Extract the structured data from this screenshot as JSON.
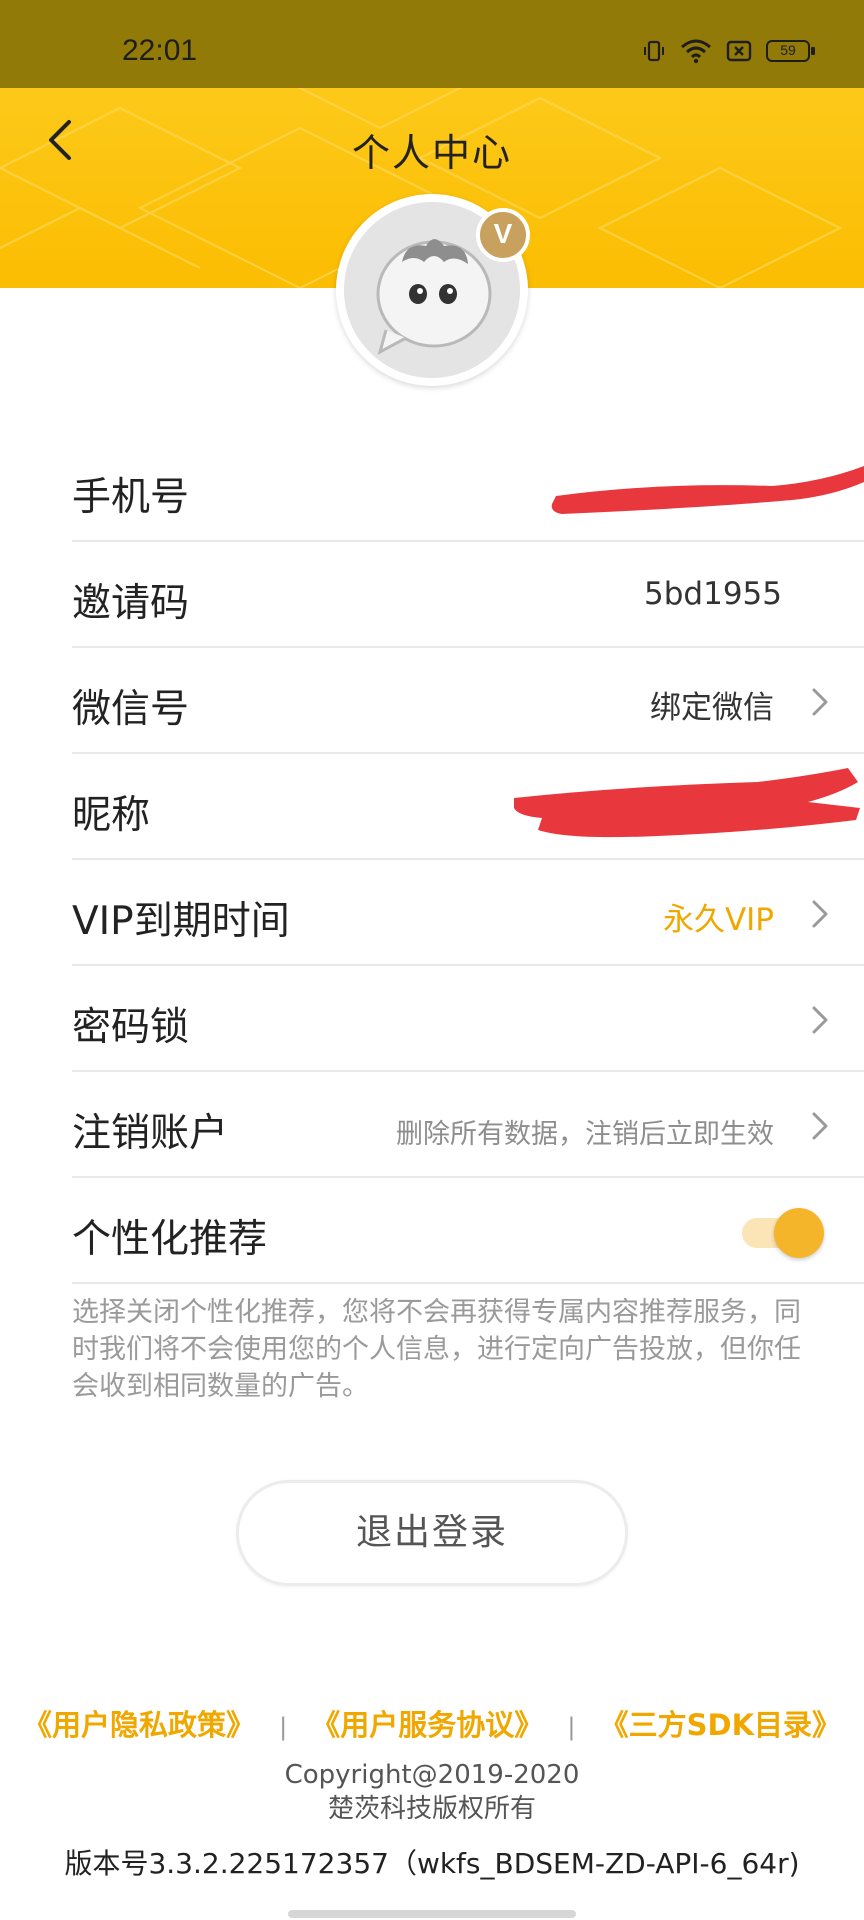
{
  "status_bar": {
    "time": "22:01",
    "battery": "59",
    "icons": [
      "vibrate-icon",
      "wifi-icon",
      "sim-icon",
      "battery-icon"
    ]
  },
  "header": {
    "title": "个人中心",
    "back_icon": "chevron-left-icon",
    "background_color": "#fbbd02",
    "vip_badge": "V"
  },
  "rows": [
    {
      "label": "手机号",
      "value": ""
    },
    {
      "label": "邀请码",
      "value": "5bd1955"
    },
    {
      "label": "微信号",
      "value": "绑定微信"
    },
    {
      "label": "昵称",
      "value": ""
    },
    {
      "label": "VIP到期时间",
      "value": "永久VIP"
    },
    {
      "label": "密码锁",
      "value": ""
    },
    {
      "label": "注销账户",
      "value": "删除所有数据，注销后立即生效"
    },
    {
      "label": "个性化推荐",
      "toggle": true
    }
  ],
  "personalization_hint": "选择关闭个性化推荐，您将不会再获得专属内容推荐服务，同时我们将不会使用您的个人信息，进行定向广告投放，但你任会收到相同数量的广告。",
  "logout_label": "退出登录",
  "links": {
    "privacy": "《用户隐私政策》",
    "service": "《用户服务协议》",
    "sdk": "《三方SDK目录》",
    "separator": "|"
  },
  "copyright_line1": "Copyright@2019-2020",
  "copyright_line2": "楚茨科技版权所有",
  "version": "版本号3.3.2.225172357（wkfs_BDSEM-ZD-API-6_64r)",
  "colors": {
    "accent": "#f0a800",
    "toggle_on": "#f5b52a",
    "status_bar": "#927a09"
  }
}
